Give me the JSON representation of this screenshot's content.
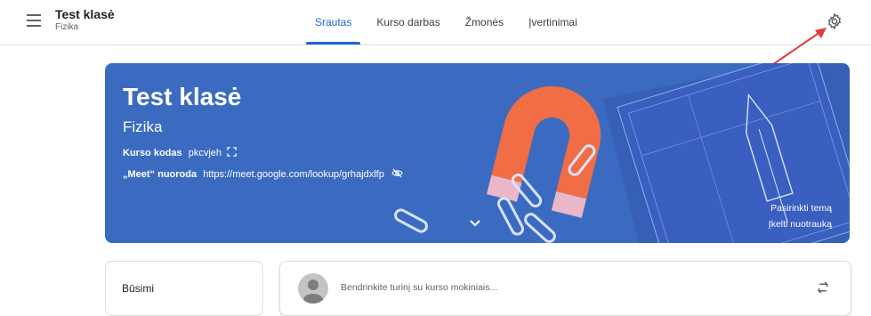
{
  "header": {
    "class_title": "Test klasė",
    "class_subject": "Fizika",
    "tabs": [
      {
        "label": "Srautas",
        "active": true
      },
      {
        "label": "Kurso darbas",
        "active": false
      },
      {
        "label": "Žmonės",
        "active": false
      },
      {
        "label": "Įvertinimai",
        "active": false
      }
    ]
  },
  "banner": {
    "title": "Test klasė",
    "subtitle": "Fizika",
    "code_label": "Kurso kodas",
    "code_value": "pkcvjeh",
    "meet_label": "„Meet“ nuoroda",
    "meet_link": "https://meet.google.com/lookup/grhajdxlfp",
    "select_theme": "Pasirinkti temą",
    "upload_photo": "Įkelti nuotrauką",
    "background_color": "#3b6bc1"
  },
  "upcoming": {
    "label": "Būsimi"
  },
  "share": {
    "placeholder": "Bendrinkite turinį su kurso mokiniais..."
  },
  "colors": {
    "accent": "#1967d2",
    "annotation_arrow": "#e53935"
  }
}
